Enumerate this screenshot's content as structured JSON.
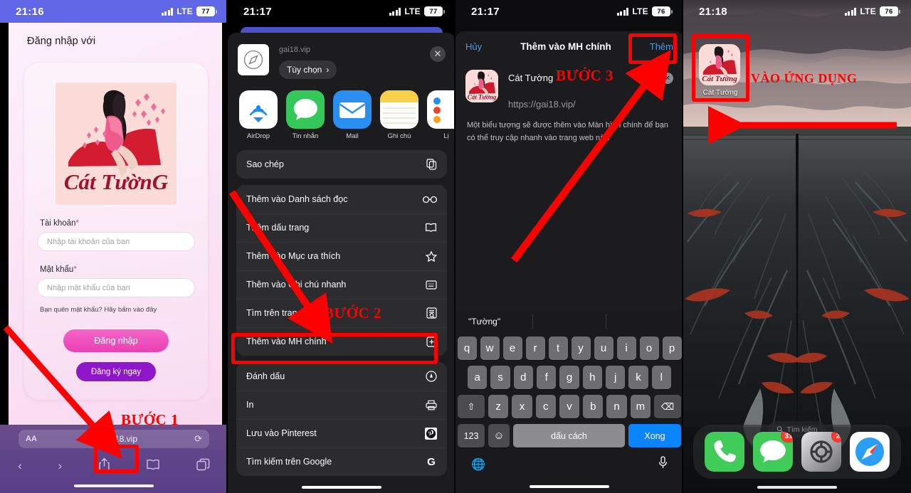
{
  "panels": [
    {
      "status": {
        "time": "21:16",
        "network": "LTE",
        "battery": "77"
      },
      "page": {
        "title": "Đăng nhập với",
        "logo_text": "Cát TườnG",
        "fields": [
          {
            "label": "Tài khoản",
            "required": "*",
            "placeholder": "Nhập tài khoản của bạn"
          },
          {
            "label": "Mật khẩu",
            "required": "*",
            "placeholder": "Nhập mật khẩu của bạn"
          }
        ],
        "forgot": "Bạn quên mật khẩu? Hãy bấm vào đây",
        "login_button": "Đăng nhập",
        "register_button": "Đăng ký ngay"
      },
      "browser": {
        "aa": "AA",
        "url": "gai18.vip",
        "lock_icon": "lock-icon",
        "reload_icon": "reload-icon",
        "back_icon": "back-icon",
        "forward_icon": "forward-icon",
        "share_icon": "share-icon",
        "bookmarks_icon": "bookmarks-icon",
        "tabs_icon": "tabs-icon"
      },
      "annotation": {
        "step": "BƯỚC 1"
      }
    },
    {
      "status": {
        "time": "21:17",
        "network": "LTE",
        "battery": "77"
      },
      "share": {
        "host": "gai18.vip",
        "options_label": "Tùy chọn",
        "close_icon": "close-icon",
        "apps": [
          {
            "name": "AirDrop",
            "icon": "airdrop-icon"
          },
          {
            "name": "Tin nhắn",
            "icon": "messages-icon"
          },
          {
            "name": "Mail",
            "icon": "mail-icon"
          },
          {
            "name": "Ghi chú",
            "icon": "notes-icon"
          },
          {
            "name": "Lị",
            "icon": "calendar-icon"
          }
        ],
        "group1": [
          {
            "label": "Sao chép",
            "icon": "copy-icon"
          }
        ],
        "group2": [
          {
            "label": "Thêm vào Danh sách đọc",
            "icon": "glasses-icon"
          },
          {
            "label": "Thêm dấu trang",
            "icon": "book-icon"
          },
          {
            "label": "Thêm vào Mục ưa thích",
            "icon": "star-icon"
          },
          {
            "label": "Thêm vào Ghi chú nhanh",
            "icon": "quicknote-icon"
          },
          {
            "label": "Tìm trên trang",
            "icon": "find-page-icon"
          },
          {
            "label": "Thêm vào MH chính",
            "icon": "add-home-icon"
          }
        ],
        "group3": [
          {
            "label": "Đánh dấu",
            "icon": "markup-icon"
          },
          {
            "label": "In",
            "icon": "print-icon"
          },
          {
            "label": "Lưu vào Pinterest",
            "icon": "pinterest-icon"
          },
          {
            "label": "Tìm kiếm trên Google",
            "icon": "google-icon"
          }
        ]
      },
      "annotation": {
        "step": "BƯỚC 2"
      }
    },
    {
      "status": {
        "time": "21:17",
        "network": "LTE",
        "battery": "76"
      },
      "dialog": {
        "cancel": "Hủy",
        "title": "Thêm vào MH chính",
        "confirm": "Thêm",
        "app_name": "Cát Tường",
        "app_url": "https://gai18.vip/",
        "clear_icon": "clear-icon",
        "description": "Một biểu tượng sẽ được thêm vào Màn hình chính để bạn có thể truy cập nhanh vào trang web này."
      },
      "keyboard": {
        "prediction": "\"Tường\"",
        "row1": [
          "q",
          "w",
          "e",
          "r",
          "t",
          "y",
          "u",
          "i",
          "o",
          "p"
        ],
        "row2": [
          "a",
          "s",
          "d",
          "f",
          "g",
          "h",
          "j",
          "k",
          "l"
        ],
        "row3": [
          "z",
          "x",
          "c",
          "v",
          "b",
          "n",
          "m"
        ],
        "shift_icon": "shift-icon",
        "backspace_icon": "backspace-icon",
        "numbers_key": "123",
        "emoji_icon": "emoji-icon",
        "space_key": "dấu cách",
        "done_key": "Xong",
        "globe_icon": "globe-icon",
        "mic_icon": "mic-icon"
      },
      "annotation": {
        "step": "BƯỚC 3"
      }
    },
    {
      "status": {
        "time": "21:18",
        "network": "LTE",
        "battery": "76"
      },
      "home": {
        "app_label": "Cát Tường",
        "search_label": "Tìm kiếm",
        "search_icon": "search-icon",
        "dock": [
          {
            "name": "Điện thoại",
            "icon": "phone-icon",
            "badge": ""
          },
          {
            "name": "Tin nhắn",
            "icon": "messages-icon",
            "badge": "31"
          },
          {
            "name": "Cài đặt",
            "icon": "settings-icon",
            "badge": "2"
          },
          {
            "name": "Safari",
            "icon": "safari-icon",
            "badge": ""
          }
        ]
      },
      "annotation": {
        "step": "VÀO ỨNG DỤNG"
      }
    }
  ],
  "colors": {
    "annotation_red": "#ff0000",
    "login_header": "#6168e8",
    "primary_button": "#ec3fb4",
    "secondary_button": "#8e17c9",
    "ios_blue": "#0a84ff"
  }
}
